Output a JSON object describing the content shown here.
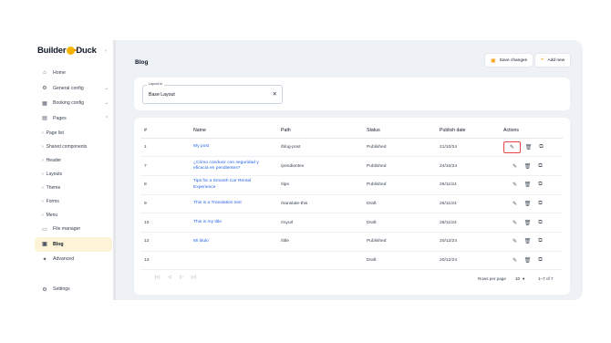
{
  "logo": {
    "text_left": "Builder",
    "text_right": "Duck"
  },
  "sidebar": {
    "collapse_icon": "chevron-left",
    "items": [
      {
        "label": "Home",
        "icon": "home-icon",
        "glyph": "⌂"
      },
      {
        "label": "General config",
        "icon": "gear-icon",
        "glyph": "⚙",
        "chevron": "⌄"
      },
      {
        "label": "Booking config",
        "icon": "calendar-icon",
        "glyph": "▦",
        "chevron": "⌄"
      },
      {
        "label": "Pages",
        "icon": "pages-icon",
        "glyph": "▤",
        "chevron": "⌃"
      }
    ],
    "sub_items": [
      "Page list",
      "Shared components",
      "Header",
      "Layouts",
      "Theme",
      "Forms",
      "Menu"
    ],
    "bottom_items": [
      {
        "label": "File manager",
        "icon": "folder-icon",
        "glyph": "▭"
      },
      {
        "label": "Blog",
        "icon": "blog-icon",
        "glyph": "▣",
        "active": true
      },
      {
        "label": "Advanced",
        "icon": "advanced-icon",
        "glyph": "✦"
      }
    ],
    "settings": {
      "label": "Settings",
      "icon": "settings-icon",
      "glyph": "⚙"
    }
  },
  "header": {
    "title": "Blog",
    "save_label": "Save changes",
    "add_label": "Add new"
  },
  "layout_field": {
    "label": "Layout id",
    "value": "Base Layout",
    "clear": "✕"
  },
  "table": {
    "columns": [
      "#",
      "Name",
      "Path",
      "Status",
      "Publish date",
      "Actions"
    ],
    "rows": [
      {
        "num": "1",
        "name": "My post",
        "path": "/blog-post",
        "status": "Published",
        "date": "21/10/24"
      },
      {
        "num": "7",
        "name": "¿Cómo conducir con seguridad y eficacia en pendientes?",
        "path": "/pendientes",
        "status": "Published",
        "date": "24/10/24"
      },
      {
        "num": "8",
        "name": "Tips for a Smooth Car Rental Experience",
        "path": "/tips",
        "status": "Published",
        "date": "26/11/24"
      },
      {
        "num": "9",
        "name": "This is a Translation test",
        "path": "/translate-this",
        "status": "Draft",
        "date": "26/11/24"
      },
      {
        "num": "10",
        "name": "This is my title",
        "path": "/myurl",
        "status": "Draft",
        "date": "28/11/24"
      },
      {
        "num": "12",
        "name": "Mi titulo",
        "path": "/title",
        "status": "Published",
        "date": "20/12/24"
      },
      {
        "num": "13",
        "name": "",
        "path": "",
        "status": "Draft",
        "date": "20/12/24"
      }
    ]
  },
  "pagination": {
    "first": "|◁",
    "prev": "◁",
    "next": "▷",
    "last": "▷|",
    "rows_per_page_label": "Rows per page",
    "rows_per_page_value": "10",
    "range": "1–7 of 7"
  },
  "colors": {
    "accent": "#f59e0b",
    "active_bg": "#fdf3d7",
    "link": "#2563eb",
    "highlight": "#ef4444"
  }
}
